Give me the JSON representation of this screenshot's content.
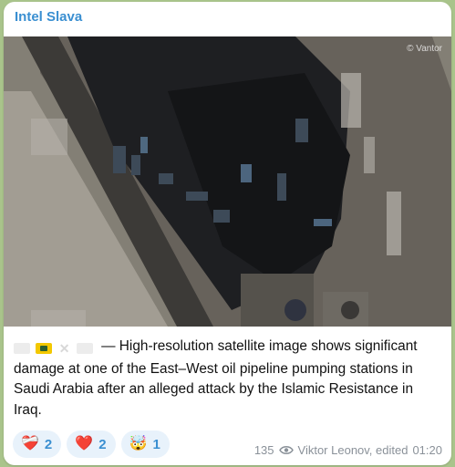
{
  "channel": {
    "name": "Intel Slava"
  },
  "media": {
    "watermark": "© Vantor"
  },
  "caption": {
    "flags": [
      "flag-white",
      "flag-yellow",
      "flag-x",
      "flag-white"
    ],
    "text": "— High-resolution satellite image shows significant damage at one of the East–West oil pipeline pumping stations in Saudi Arabia after an alleged attack by the Islamic Resistance in Iraq."
  },
  "reactions": [
    {
      "icon": "broken-heart-icon",
      "emoji": "❤️‍🩹",
      "count": "2"
    },
    {
      "icon": "red-heart-icon",
      "emoji": "❤️",
      "count": "2"
    },
    {
      "icon": "exploding-head-icon",
      "emoji": "🤯",
      "count": "1"
    }
  ],
  "meta": {
    "views": "135",
    "author_edited": "Viktor Leonov, edited",
    "time": "01:20"
  },
  "colors": {
    "accent": "#3a8fd1",
    "background": "#a9c48b",
    "reaction_bg": "#e8f2fb"
  }
}
